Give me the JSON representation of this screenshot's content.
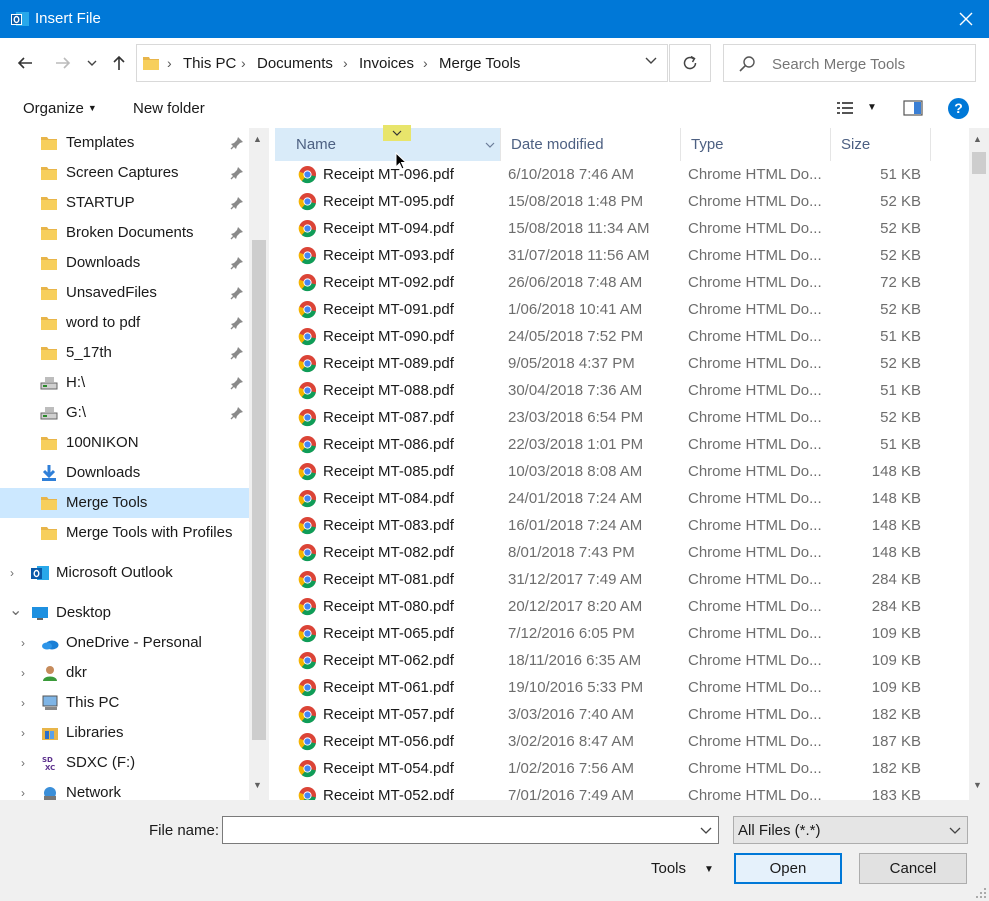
{
  "window": {
    "title": "Insert File",
    "accent": "#0078d7"
  },
  "address": {
    "crumbs": [
      "This PC",
      "Documents",
      "Invoices",
      "Merge Tools"
    ]
  },
  "search": {
    "placeholder": "Search Merge Tools"
  },
  "toolbar": {
    "organize": "Organize",
    "new_folder": "New folder"
  },
  "nav": {
    "quick": [
      {
        "label": "Templates",
        "icon": "folder-icon",
        "pinned": true
      },
      {
        "label": "Screen Captures",
        "icon": "folder-icon",
        "pinned": true
      },
      {
        "label": "STARTUP",
        "icon": "folder-icon",
        "pinned": true
      },
      {
        "label": "Broken Documents",
        "icon": "folder-icon",
        "pinned": true
      },
      {
        "label": "Downloads",
        "icon": "folder-icon",
        "pinned": true
      },
      {
        "label": "UnsavedFiles",
        "icon": "folder-icon",
        "pinned": true
      },
      {
        "label": "word to pdf",
        "icon": "folder-icon",
        "pinned": true
      },
      {
        "label": "5_17th",
        "icon": "folder-icon",
        "pinned": true
      },
      {
        "label": "H:\\",
        "icon": "network-drive-icon",
        "pinned": true
      },
      {
        "label": "G:\\",
        "icon": "network-drive-icon",
        "pinned": true
      },
      {
        "label": "100NIKON",
        "icon": "folder-icon",
        "pinned": false
      },
      {
        "label": "Downloads",
        "icon": "download-icon",
        "pinned": false
      },
      {
        "label": "Merge Tools",
        "icon": "folder-icon",
        "pinned": false,
        "selected": true
      },
      {
        "label": "Merge Tools with Profiles",
        "icon": "folder-icon",
        "pinned": false
      }
    ],
    "outlook": "Microsoft Outlook",
    "desktop": "Desktop",
    "desktop_children": [
      {
        "label": "OneDrive - Personal",
        "icon": "onedrive-icon"
      },
      {
        "label": "dkr",
        "icon": "user-folder-icon"
      },
      {
        "label": "This PC",
        "icon": "computer-icon"
      },
      {
        "label": "Libraries",
        "icon": "libraries-icon"
      },
      {
        "label": "SDXC (F:)",
        "icon": "sd-card-icon"
      },
      {
        "label": "Network",
        "icon": "network-icon"
      }
    ]
  },
  "columns": {
    "name": "Name",
    "date": "Date modified",
    "type": "Type",
    "size": "Size"
  },
  "files": [
    {
      "name": "Receipt MT-096.pdf",
      "date": "6/10/2018 7:46 AM",
      "type": "Chrome HTML Do...",
      "size": "51 KB"
    },
    {
      "name": "Receipt MT-095.pdf",
      "date": "15/08/2018 1:48 PM",
      "type": "Chrome HTML Do...",
      "size": "52 KB"
    },
    {
      "name": "Receipt MT-094.pdf",
      "date": "15/08/2018 11:34 AM",
      "type": "Chrome HTML Do...",
      "size": "52 KB"
    },
    {
      "name": "Receipt MT-093.pdf",
      "date": "31/07/2018 11:56 AM",
      "type": "Chrome HTML Do...",
      "size": "52 KB"
    },
    {
      "name": "Receipt MT-092.pdf",
      "date": "26/06/2018 7:48 AM",
      "type": "Chrome HTML Do...",
      "size": "72 KB"
    },
    {
      "name": "Receipt MT-091.pdf",
      "date": "1/06/2018 10:41 AM",
      "type": "Chrome HTML Do...",
      "size": "52 KB"
    },
    {
      "name": "Receipt MT-090.pdf",
      "date": "24/05/2018 7:52 PM",
      "type": "Chrome HTML Do...",
      "size": "51 KB"
    },
    {
      "name": "Receipt MT-089.pdf",
      "date": "9/05/2018 4:37 PM",
      "type": "Chrome HTML Do...",
      "size": "52 KB"
    },
    {
      "name": "Receipt MT-088.pdf",
      "date": "30/04/2018 7:36 AM",
      "type": "Chrome HTML Do...",
      "size": "51 KB"
    },
    {
      "name": "Receipt MT-087.pdf",
      "date": "23/03/2018 6:54 PM",
      "type": "Chrome HTML Do...",
      "size": "52 KB"
    },
    {
      "name": "Receipt MT-086.pdf",
      "date": "22/03/2018 1:01 PM",
      "type": "Chrome HTML Do...",
      "size": "51 KB"
    },
    {
      "name": "Receipt MT-085.pdf",
      "date": "10/03/2018 8:08 AM",
      "type": "Chrome HTML Do...",
      "size": "148 KB"
    },
    {
      "name": "Receipt MT-084.pdf",
      "date": "24/01/2018 7:24 AM",
      "type": "Chrome HTML Do...",
      "size": "148 KB"
    },
    {
      "name": "Receipt MT-083.pdf",
      "date": "16/01/2018 7:24 AM",
      "type": "Chrome HTML Do...",
      "size": "148 KB"
    },
    {
      "name": "Receipt MT-082.pdf",
      "date": "8/01/2018 7:43 PM",
      "type": "Chrome HTML Do...",
      "size": "148 KB"
    },
    {
      "name": "Receipt MT-081.pdf",
      "date": "31/12/2017 7:49 AM",
      "type": "Chrome HTML Do...",
      "size": "284 KB"
    },
    {
      "name": "Receipt MT-080.pdf",
      "date": "20/12/2017 8:20 AM",
      "type": "Chrome HTML Do...",
      "size": "284 KB"
    },
    {
      "name": "Receipt MT-065.pdf",
      "date": "7/12/2016 6:05 PM",
      "type": "Chrome HTML Do...",
      "size": "109 KB"
    },
    {
      "name": "Receipt MT-062.pdf",
      "date": "18/11/2016 6:35 AM",
      "type": "Chrome HTML Do...",
      "size": "109 KB"
    },
    {
      "name": "Receipt MT-061.pdf",
      "date": "19/10/2016 5:33 PM",
      "type": "Chrome HTML Do...",
      "size": "109 KB"
    },
    {
      "name": "Receipt MT-057.pdf",
      "date": "3/03/2016 7:40 AM",
      "type": "Chrome HTML Do...",
      "size": "182 KB"
    },
    {
      "name": "Receipt MT-056.pdf",
      "date": "3/02/2016 8:47 AM",
      "type": "Chrome HTML Do...",
      "size": "187 KB"
    },
    {
      "name": "Receipt MT-054.pdf",
      "date": "1/02/2016 7:56 AM",
      "type": "Chrome HTML Do...",
      "size": "182 KB"
    },
    {
      "name": "Receipt MT-052.pdf",
      "date": "7/01/2016 7:49 AM",
      "type": "Chrome HTML Do...",
      "size": "183 KB"
    }
  ],
  "footer": {
    "file_name_label": "File name:",
    "file_name_value": "",
    "filter_value": "All Files (*.*)",
    "tools": "Tools",
    "open": "Open",
    "cancel": "Cancel"
  }
}
